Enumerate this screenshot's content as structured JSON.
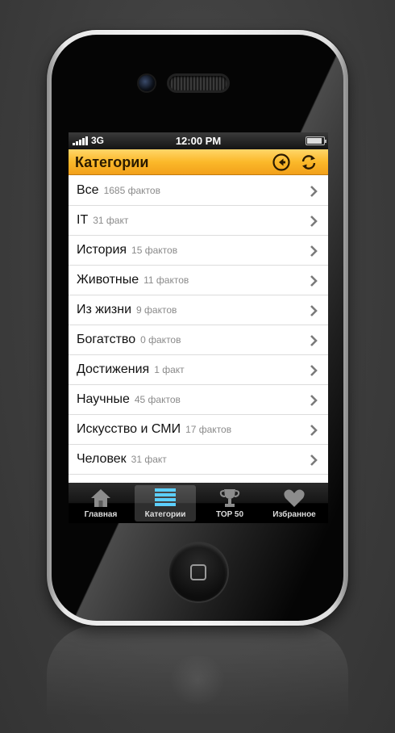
{
  "status_bar": {
    "network": "3G",
    "time": "12:00 PM"
  },
  "nav": {
    "title": "Категории",
    "back_icon": "back-arrow-icon",
    "refresh_icon": "refresh-icon"
  },
  "categories": [
    {
      "name": "Все",
      "count": "1685 фактов"
    },
    {
      "name": "IT",
      "count": "31 факт"
    },
    {
      "name": "История",
      "count": "15 фактов"
    },
    {
      "name": "Животные",
      "count": "11 фактов"
    },
    {
      "name": "Из жизни",
      "count": "9 фактов"
    },
    {
      "name": "Богатство",
      "count": "0 фактов"
    },
    {
      "name": "Достижения",
      "count": "1 факт"
    },
    {
      "name": "Научные",
      "count": "45 фактов"
    },
    {
      "name": "Искусство и СМИ",
      "count": "17 фактов"
    },
    {
      "name": "Человек",
      "count": "31 факт"
    }
  ],
  "tabs": [
    {
      "label": "Главная",
      "icon": "home-icon",
      "active": false
    },
    {
      "label": "Категории",
      "icon": "list-icon",
      "active": true
    },
    {
      "label": "TOP  50",
      "icon": "trophy-icon",
      "active": false
    },
    {
      "label": "Избранное",
      "icon": "heart-icon",
      "active": false
    }
  ],
  "colors": {
    "nav_bar": "#fbb92a",
    "active_tab_icon": "#5ccfff"
  }
}
